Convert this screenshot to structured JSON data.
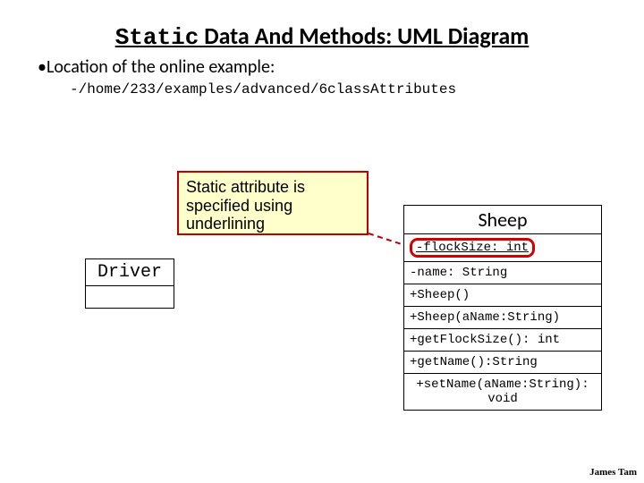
{
  "title_prefix": "Static",
  "title_rest": " Data And Methods: UML Diagram",
  "bullet": "•Location of the online example:",
  "subbullet": "-/home/233/examples/advanced/6classAttributes",
  "callout": "Static attribute is specified using underlining",
  "driver": {
    "title": "Driver"
  },
  "sheep": {
    "title": "Sheep",
    "rows": [
      "-flockSize: int",
      "-name: String",
      "+Sheep()",
      "+Sheep(aName:String)",
      "+getFlockSize(): int",
      "+getName():String",
      "+setName(aName:String): void"
    ]
  },
  "author": "James Tam"
}
